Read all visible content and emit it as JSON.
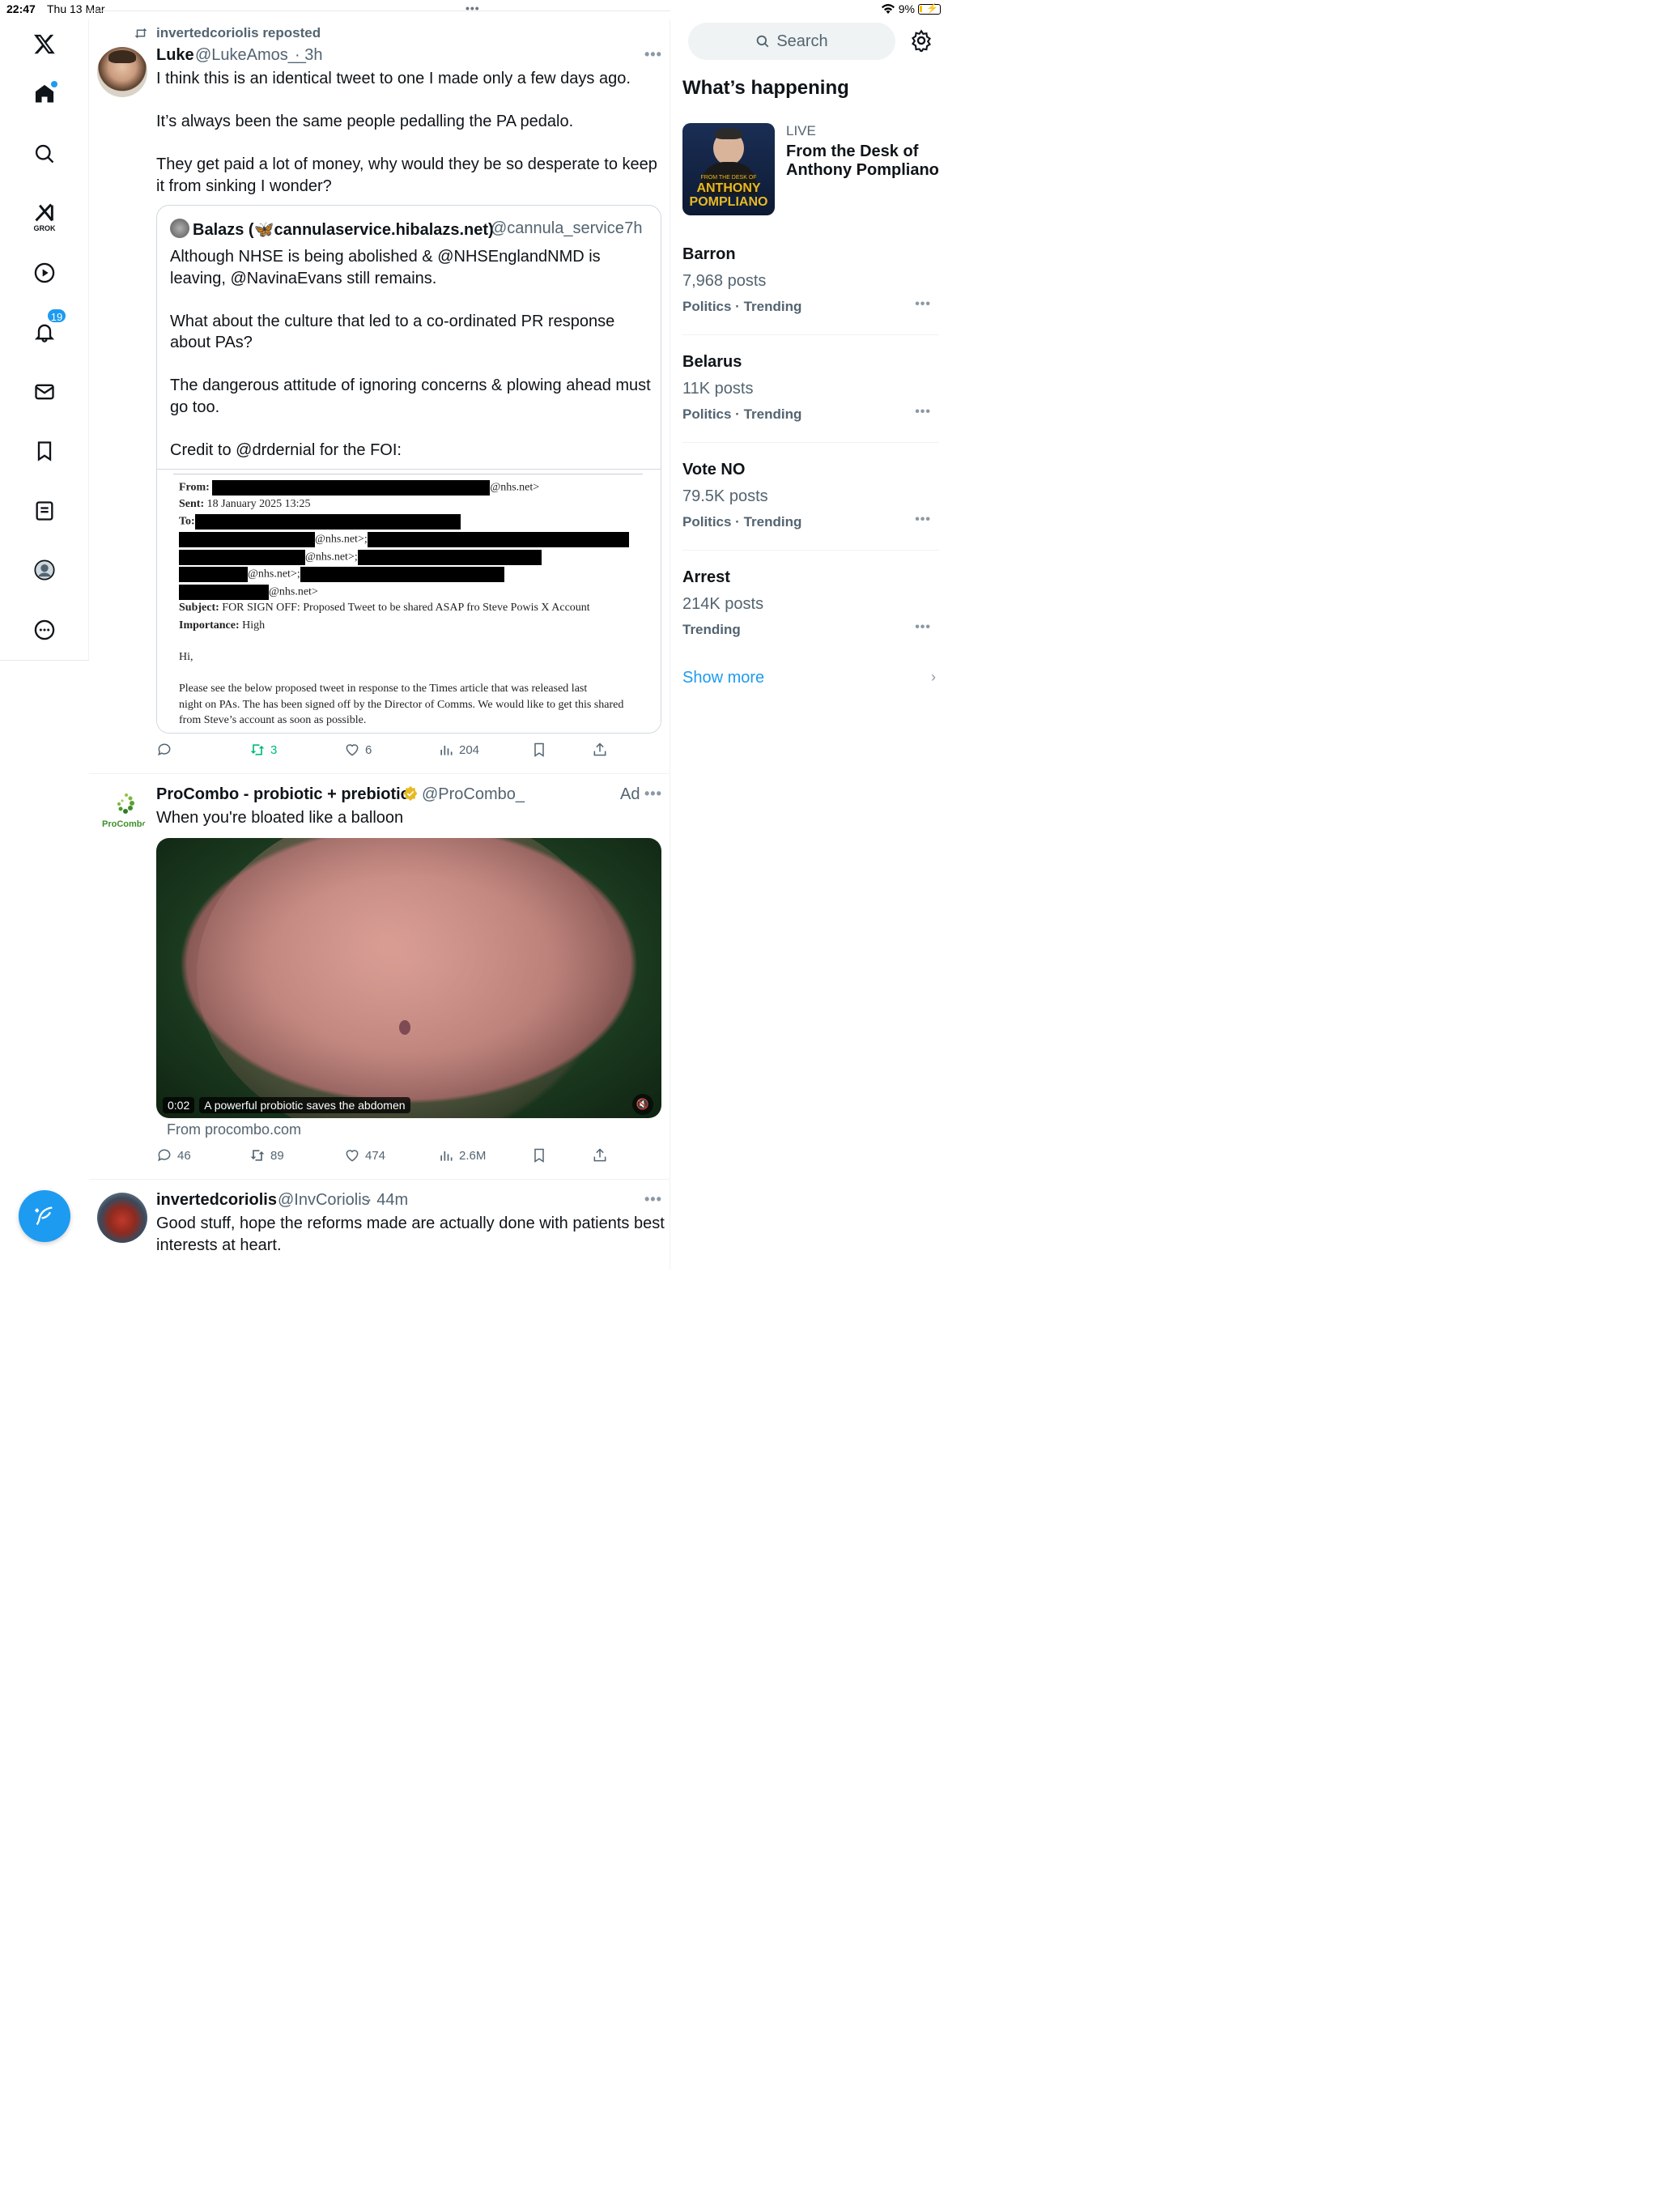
{
  "status_bar": {
    "time": "22:47",
    "date": "Thu 13 Mar",
    "battery": "9%",
    "top_dots": "•••"
  },
  "nav": {
    "grok_label": "GROK",
    "notifications_badge": "19"
  },
  "tweet1": {
    "repost_by": "invertedcoriolis reposted",
    "name": "Luke",
    "handle": "@LukeAmos__",
    "time": "· 3h",
    "text": "I think this is an identical tweet to one I made only a few days ago.\n\nIt’s always been the same people pedalling the PA pedalo.\n\nThey get paid a lot of money, why would they be so desperate to keep it from sinking I wonder?",
    "quote": {
      "name": "Balazs (🦋cannulaservice.hibalazs.net)",
      "handle": "@cannula_service",
      "time": "· 7h",
      "text": "Although NHSE is being abolished & @NHSEnglandNMD is leaving, @NavinaEvans still remains.\n\nWhat about the culture that led to a co-ordinated PR response about PAs?\n\nThe dangerous attitude of ignoring concerns & plowing ahead must go too.\n\nCredit to @drdernial for the FOI:",
      "doc": {
        "from_label": "From:",
        "from_suffix": "@nhs.net>",
        "sent_label": "Sent:",
        "sent_value": "18 January 2025 13:25",
        "to_label": "To:",
        "addr1": "@nhs.net>;",
        "addr2": "@nhs.net>;",
        "addr3": "@nhs.net>;",
        "addr4": "@nhs.net>",
        "subject_label": "Subject:",
        "subject_value": "FOR SIGN OFF: Proposed Tweet to be shared ASAP fro Steve Powis X Account",
        "importance_label": "Importance:",
        "importance_value": "High",
        "greeting": "Hi,",
        "para1": "Please see the below proposed tweet in response to the Times article that was released last",
        "para2": "night on PAs. The has been signed off by the Director of Comms. We would like to get this shared",
        "para3": "from Steve’s account as soon as possible."
      }
    },
    "actions": {
      "reposts": "3",
      "likes": "6",
      "views": "204"
    }
  },
  "ad": {
    "logo_text": "ProCombo",
    "name": "ProCombo - probiotic + prebiotic",
    "handle": "@ProCombo_",
    "ad_label": "Ad",
    "text": "When you're bloated like a balloon",
    "video_time": "0:02",
    "video_caption": "A powerful probiotic saves the abdomen",
    "source": "From procombo.com",
    "actions": {
      "replies": "46",
      "reposts": "89",
      "likes": "474",
      "views": "2.6M"
    }
  },
  "tweet3": {
    "name": "invertedcoriolis",
    "handle": "@InvCoriolis",
    "time": "· 44m",
    "text": "Good stuff, hope the reforms made are actually done with patients best interests at heart."
  },
  "sidebar": {
    "search_placeholder": "Search",
    "title": "What’s happening",
    "live": {
      "label": "LIVE",
      "title": "From the Desk of Anthony Pompliano",
      "thumb_small": "FROM THE DESK OF",
      "thumb_line1": "ANTHONY",
      "thumb_line2": "POMPLIANO"
    },
    "trends": [
      {
        "name": "Barron",
        "posts": "7,968 posts",
        "category": "Politics · Trending"
      },
      {
        "name": "Belarus",
        "posts": "11K posts",
        "category": "Politics · Trending"
      },
      {
        "name": "Vote NO",
        "posts": "79.5K posts",
        "category": "Politics · Trending"
      },
      {
        "name": "Arrest",
        "posts": "214K posts",
        "category": "Trending"
      }
    ],
    "show_more": "Show more"
  },
  "colors": {
    "accent": "#1d9bf0",
    "repost_green": "#00ba7c",
    "muted": "#536471"
  }
}
